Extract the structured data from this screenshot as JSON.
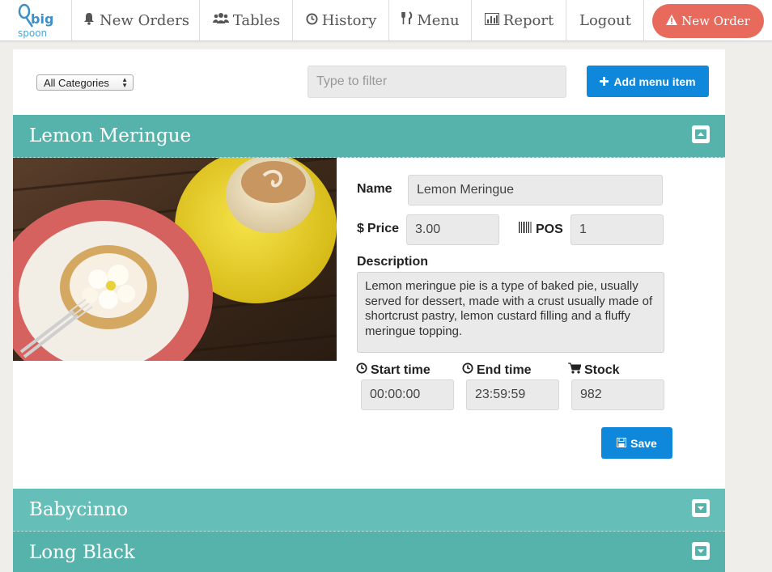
{
  "logo": {
    "word_top": "big",
    "word_bottom": "spoon"
  },
  "nav": {
    "new_orders": "New Orders",
    "tables": "Tables",
    "history": "History",
    "menu": "Menu",
    "report": "Report",
    "logout": "Logout",
    "new_order": "New Order"
  },
  "toolbar": {
    "category_selected": "All Categories",
    "filter_placeholder": "Type to filter",
    "add_label": "Add menu item"
  },
  "items": [
    {
      "title": "Lemon Meringue",
      "expanded": true,
      "name_label": "Name",
      "name_value": "Lemon Meringue",
      "price_label": "Price",
      "price_value": "3.00",
      "pos_label": "POS",
      "pos_value": "1",
      "description_label": "Description",
      "description_value": "Lemon meringue pie is a type of baked pie, usually served for dessert, made with a crust usually made of shortcrust pastry, lemon custard filling and a fluffy meringue topping.",
      "start_label": "Start time",
      "start_value": "00:00:00",
      "end_label": "End time",
      "end_value": "23:59:59",
      "stock_label": "Stock",
      "stock_value": "982",
      "save_label": "Save"
    },
    {
      "title": "Babycinno",
      "expanded": false
    },
    {
      "title": "Long Black",
      "expanded": false
    }
  ],
  "colors": {
    "accent_blue": "#0f88dc",
    "teal_header": "#55b3ab",
    "new_order_red": "#e86a5c"
  }
}
